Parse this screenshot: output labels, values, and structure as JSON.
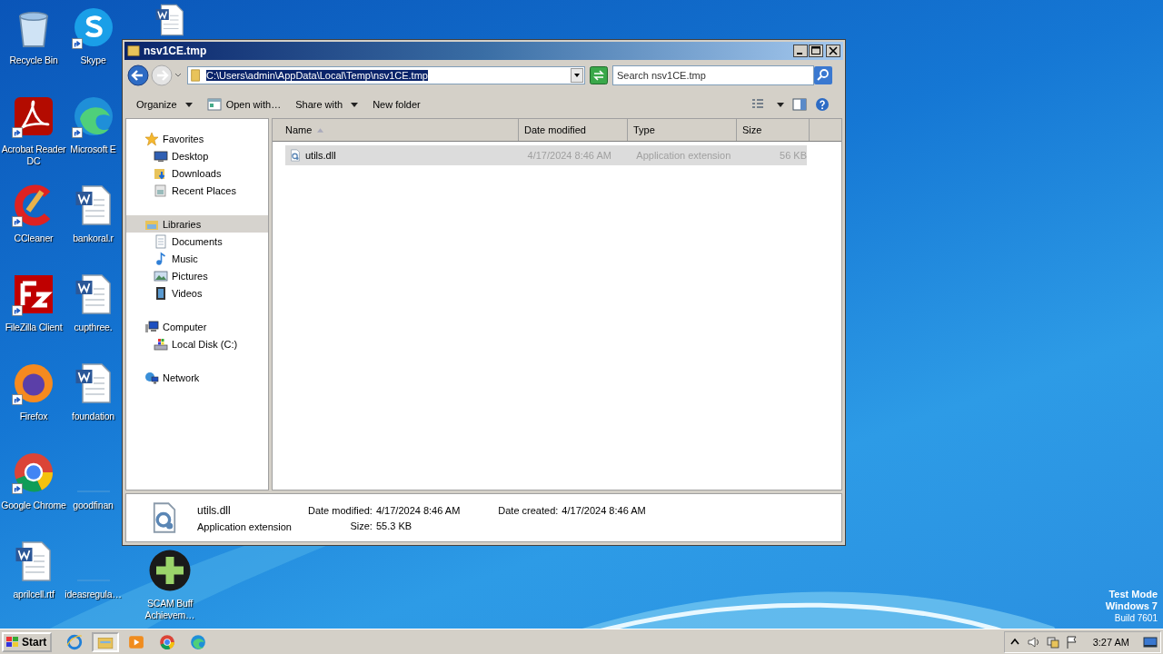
{
  "desktop_icons": [
    {
      "label": "Recycle Bin",
      "kind": "recycle"
    },
    {
      "label": "Acrobat Reader DC",
      "kind": "acrobat",
      "shortcut": true
    },
    {
      "label": "CCleaner",
      "kind": "ccleaner",
      "shortcut": true
    },
    {
      "label": "FileZilla Client",
      "kind": "filezilla",
      "shortcut": true
    },
    {
      "label": "Firefox",
      "kind": "firefox",
      "shortcut": true
    },
    {
      "label": "Google Chrome",
      "kind": "chrome",
      "shortcut": true
    },
    {
      "label": "aprilcell.rtf",
      "kind": "word"
    },
    {
      "label": "Skype",
      "kind": "skype",
      "shortcut": true
    },
    {
      "label": "Microsoft E",
      "kind": "edge",
      "shortcut": true
    },
    {
      "label": "bankoral.r",
      "kind": "word"
    },
    {
      "label": "cupthree.",
      "kind": "word"
    },
    {
      "label": "foundation",
      "kind": "word"
    },
    {
      "label": "goodfinan",
      "kind": "blank"
    },
    {
      "label": "ideasregula…",
      "kind": "blank"
    },
    {
      "kind": "word"
    },
    {
      "label": "SCAM Buff Achievem…",
      "kind": "game"
    }
  ],
  "window": {
    "title": "nsv1CE.tmp",
    "address": {
      "value": "C:\\Users\\admin\\AppData\\Local\\Temp\\nsv1CE.tmp",
      "selected": true
    },
    "search": {
      "placeholder": "Search nsv1CE.tmp"
    },
    "toolbar": [
      {
        "label": "Organize",
        "kind": "menu"
      },
      {
        "label": "Open with…",
        "kind": "open"
      },
      {
        "label": "Share with",
        "kind": "menu"
      },
      {
        "label": "New folder",
        "kind": "plain"
      }
    ],
    "nav_pane": [
      {
        "label": "Favorites",
        "kind": "star",
        "selected": false,
        "children": [
          {
            "label": "Desktop",
            "kind": "monitor",
            "selected": false
          },
          {
            "label": "Downloads",
            "kind": "downloads",
            "selected": false
          },
          {
            "label": "Recent Places",
            "kind": "recent",
            "selected": false
          }
        ]
      },
      {
        "label": "Libraries",
        "kind": "library",
        "selected": true,
        "children": [
          {
            "label": "Documents",
            "kind": "document",
            "selected": false
          },
          {
            "label": "Music",
            "kind": "music",
            "selected": false
          },
          {
            "label": "Pictures",
            "kind": "pictures",
            "selected": false
          },
          {
            "label": "Videos",
            "kind": "videos",
            "selected": false
          }
        ]
      },
      {
        "label": "Computer",
        "kind": "computer",
        "selected": false,
        "children": [
          {
            "label": "Local Disk (C:)",
            "kind": "disk",
            "selected": false
          }
        ]
      },
      {
        "label": "Network",
        "kind": "network",
        "selected": false
      }
    ],
    "columns": [
      {
        "label": "Name",
        "sorted": true
      },
      {
        "label": "Date modified",
        "sorted": false
      },
      {
        "label": "Type",
        "sorted": false
      },
      {
        "label": "Size",
        "sorted": false
      }
    ],
    "files": [
      {
        "name": "utils.dll",
        "date_modified": "4/17/2024 8:46 AM",
        "type": "Application extension",
        "size": "56 KB",
        "selected": true
      }
    ],
    "details": {
      "name": "utils.dll",
      "type": "Application extension",
      "fields": [
        {
          "label": "Date modified:",
          "value": "4/17/2024 8:46 AM"
        },
        {
          "label": "Date created:",
          "value": "4/17/2024 8:46 AM"
        },
        {
          "label": "Size:",
          "value": "55.3 KB"
        }
      ]
    }
  },
  "system_notice": [
    "Test Mode",
    "Windows 7",
    "Build 7601"
  ],
  "taskbar": {
    "start": "Start",
    "apps": [
      {
        "kind": "ie",
        "selected": false
      },
      {
        "kind": "explorer",
        "selected": true
      },
      {
        "kind": "media",
        "selected": false
      },
      {
        "kind": "chrome",
        "selected": false
      },
      {
        "kind": "edge",
        "selected": false
      }
    ],
    "clock": "3:27 AM"
  }
}
